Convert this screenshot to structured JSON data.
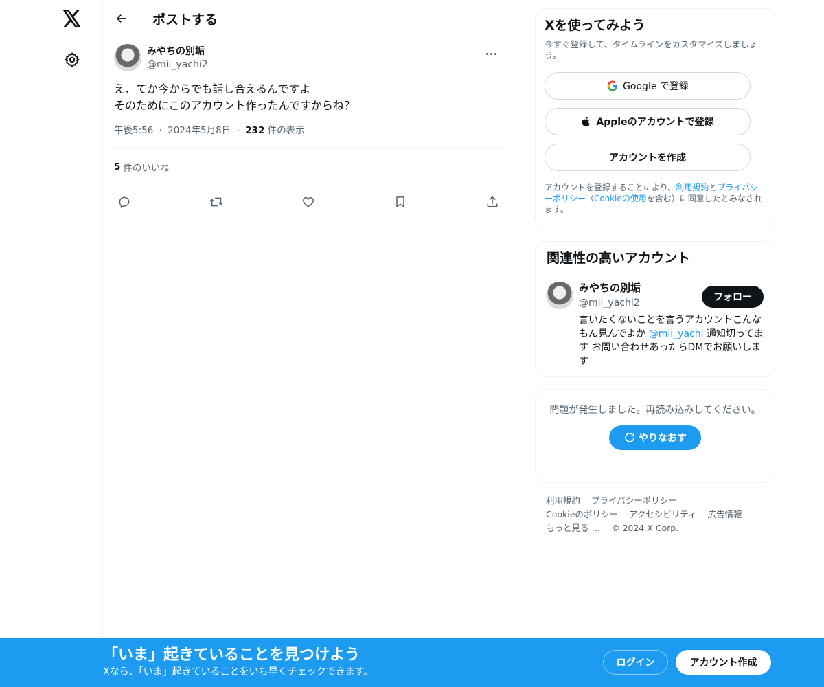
{
  "nav": {
    "logo_icon": "x-logo-icon",
    "settings_icon": "gear-icon"
  },
  "header": {
    "back_icon": "arrow-left-icon",
    "title": "ポストする"
  },
  "post": {
    "author_name": "みやちの別垢",
    "author_handle": "@mii_yachi2",
    "text": "え、てか今からでも話し合えるんですよ\nそのためにこのアカウント作ったんですからね？",
    "time": "午後5:56",
    "separator": "·",
    "date": "2024年5月8日",
    "views_count": "232",
    "views_label": "件の表示",
    "likes_count": "5",
    "likes_label": "件のいいね",
    "actions": [
      "reply-icon",
      "retweet-icon",
      "like-icon",
      "bookmark-icon",
      "share-icon"
    ]
  },
  "signup": {
    "title": "Xを使ってみよう",
    "subtitle": "今すぐ登録して、タイムラインをカスタマイズしましょう。",
    "google_label": "Google で登録",
    "apple_label": "Appleのアカウントで登録",
    "create_label": "アカウントを作成",
    "legal_prefix": "アカウントを登録することにより、",
    "legal_terms": "利用規約",
    "legal_and": "と",
    "legal_privacy": "プライバシーポリシー",
    "legal_paren_open": "（",
    "legal_cookie": "Cookieの使用",
    "legal_suffix": "を含む）に同意したとみなされます。"
  },
  "related": {
    "title": "関連性の高いアカウント",
    "name": "みやちの別垢",
    "handle": "@mii_yachi2",
    "follow_label": "フォロー",
    "bio_part1": "言いたくないことを言うアカウントこんなもん見んでよか ",
    "bio_mention": "@mii_yachi",
    "bio_part2": " 通知切ってます お問い合わせあったらDMでお願いします"
  },
  "error": {
    "message": "問題が発生しました。再読み込みしてください。",
    "retry_label": "やりなおす"
  },
  "footer": {
    "links": [
      "利用規約",
      "プライバシーポリシー",
      "Cookieのポリシー",
      "アクセシビリティ",
      "広告情報",
      "もっと見る …"
    ],
    "copyright": "© 2024 X Corp."
  },
  "banner": {
    "title": "「いま」起きていることを見つけよう",
    "subtitle": "Xなら、「いま」起きていることをいち早くチェックできます。",
    "login_label": "ログイン",
    "create_label": "アカウント作成"
  },
  "colors": {
    "accent": "#1d9bf0",
    "text": "#0f1419",
    "secondary": "#536471",
    "border": "#eff3f4"
  }
}
